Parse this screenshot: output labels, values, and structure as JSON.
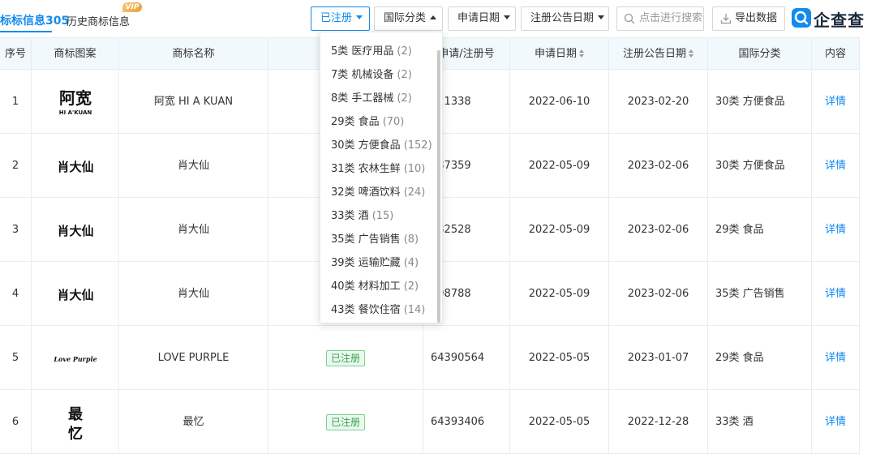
{
  "tabs": {
    "active_label": "标标信息",
    "active_count": "305",
    "history_label": "历史商标信息",
    "vip_label": "VIP"
  },
  "toolbar": {
    "status_filter": "已注册",
    "class_filter": "国际分类",
    "apply_date_filter": "申请日期",
    "notice_date_filter": "注册公告日期",
    "search_placeholder": "点击进行搜索",
    "export_label": "导出数据"
  },
  "brand": {
    "name": "企查查",
    "color": "#128bed"
  },
  "table": {
    "columns": [
      "序号",
      "商标图案",
      "商标名称",
      "",
      "申请/注册号",
      "申请日期",
      "注册公告日期",
      "国际分类",
      "内容"
    ],
    "rows": [
      {
        "index": "1",
        "logo_text": "阿宽",
        "logo_sub": "HI A'KUAN",
        "name": "阿宽 HI A KUAN",
        "status": "",
        "reg_no": "221338",
        "apply_date": "2022-06-10",
        "notice_date": "2023-02-20",
        "class": "30类 方便食品",
        "action": "详情"
      },
      {
        "index": "2",
        "logo_text": "肖大仙",
        "logo_sub": "",
        "name": "肖大仙",
        "status": "",
        "reg_no": "487359",
        "apply_date": "2022-05-09",
        "notice_date": "2023-02-06",
        "class": "30类 方便食品",
        "action": "详情"
      },
      {
        "index": "3",
        "logo_text": "肖大仙",
        "logo_sub": "",
        "name": "肖大仙",
        "status": "",
        "reg_no": "482528",
        "apply_date": "2022-05-09",
        "notice_date": "2023-02-06",
        "class": "29类 食品",
        "action": "详情"
      },
      {
        "index": "4",
        "logo_text": "肖大仙",
        "logo_sub": "",
        "name": "肖大仙",
        "status": "",
        "reg_no": "498788",
        "apply_date": "2022-05-09",
        "notice_date": "2023-02-06",
        "class": "35类 广告销售",
        "action": "详情"
      },
      {
        "index": "5",
        "logo_text": "Love Purple",
        "logo_sub": "",
        "name": "LOVE PURPLE",
        "status": "已注册",
        "reg_no": "64390564",
        "apply_date": "2022-05-05",
        "notice_date": "2023-01-07",
        "class": "29类 食品",
        "action": "详情"
      },
      {
        "index": "6",
        "logo_text": "最忆",
        "logo_sub": "",
        "name": "最忆",
        "status": "已注册",
        "reg_no": "64393406",
        "apply_date": "2022-05-05",
        "notice_date": "2022-12-28",
        "class": "33类 酒",
        "action": "详情"
      }
    ]
  },
  "dropdown": {
    "items": [
      {
        "label": "5类 医疗用品",
        "count": "(2)"
      },
      {
        "label": "7类 机械设备",
        "count": "(2)"
      },
      {
        "label": "8类 手工器械",
        "count": "(2)"
      },
      {
        "label": "29类 食品",
        "count": "(70)"
      },
      {
        "label": "30类 方便食品",
        "count": "(152)"
      },
      {
        "label": "31类 农林生鲜",
        "count": "(10)"
      },
      {
        "label": "32类 啤酒饮料",
        "count": "(24)"
      },
      {
        "label": "33类 酒",
        "count": "(15)"
      },
      {
        "label": "35类 广告销售",
        "count": "(8)"
      },
      {
        "label": "39类 运输贮藏",
        "count": "(4)"
      },
      {
        "label": "40类 材料加工",
        "count": "(2)"
      },
      {
        "label": "43类 餐饮住宿",
        "count": "(14)"
      }
    ]
  },
  "colors": {
    "accent": "#128bed",
    "registered_green": "#2fa84f",
    "header_bg": "#f2f9fc"
  }
}
